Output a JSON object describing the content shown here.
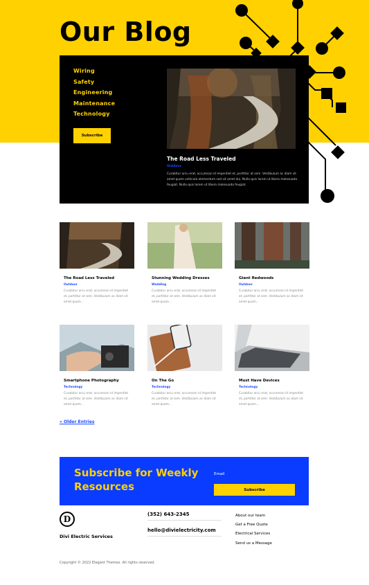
{
  "page": {
    "title": "Our Blog"
  },
  "colors": {
    "accent": "#ffd100",
    "blue": "#0a3cff",
    "dark": "#000000"
  },
  "featured": {
    "categories": [
      "Wiring",
      "Safety",
      "Engineering",
      "Maintenance",
      "Technology"
    ],
    "subscribe_label": "Subscribe",
    "post": {
      "title": "The Road Less Traveled",
      "category": "Outdoor",
      "excerpt": "Curabitur arcu erat, accumsan id imperdiet et, porttitor at sem. Vestibulum ac diam sit amet quam vehicula elementum sed sit amet dui. Nulla quis lorem ut libero malesuada feugiat. Nulla quis lorem ut libero malesuada feugiat."
    }
  },
  "posts": [
    {
      "title": "The Road Less Traveled",
      "category": "Outdoor",
      "excerpt": "Curabitur arcu erat, accumsan id imperdiet et, porttitor at sem. Vestibulum ac diam sit amet quam..."
    },
    {
      "title": "Stunning Wedding Dresses",
      "category": "Wedding",
      "excerpt": "Curabitur arcu erat, accumsan id imperdiet et, porttitor at sem. Vestibulum ac diam sit amet quam..."
    },
    {
      "title": "Giant Redwoods",
      "category": "Outdoor",
      "excerpt": "Curabitur arcu erat, accumsan id imperdiet et, porttitor at sem. Vestibulum ac diam sit amet quam..."
    },
    {
      "title": "Smartphone Photography",
      "category": "Technology",
      "excerpt": "Curabitur arcu erat, accumsan id imperdiet et, porttitor at sem. Vestibulum ac diam sit amet quam..."
    },
    {
      "title": "On The Go",
      "category": "Technology",
      "excerpt": "Curabitur arcu erat, accumsan id imperdiet et, porttitor at sem. Vestibulum ac diam sit amet quam..."
    },
    {
      "title": "Must Have Devices",
      "category": "Technology",
      "excerpt": "Curabitur arcu erat, accumsan id imperdiet et, porttitor at sem. Vestibulum ac diam sit amet quam..."
    }
  ],
  "pagination": {
    "older_label": "« Older Entries"
  },
  "subscribe": {
    "heading": "Subscribe for Weekly Resources",
    "email_label": "Email",
    "button_label": "Subscribe"
  },
  "footer": {
    "logo_letter": "D",
    "brand": "Divi Electric Services",
    "phone": "(352) 643-2345",
    "email": "hello@divielectricity.com",
    "links": [
      "About our team",
      "Get a Free Quote",
      "Electrical Services",
      "Send us a Message"
    ],
    "copyright": "Copyright © 2022 Elegant Themes. All rights reserved."
  }
}
